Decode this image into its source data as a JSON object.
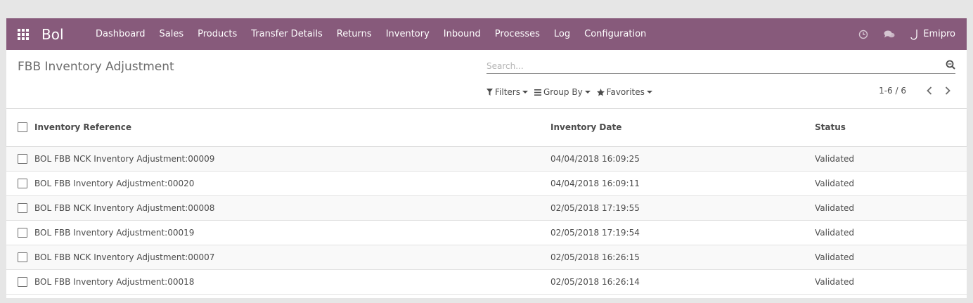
{
  "navbar": {
    "app_name": "Bol",
    "menu": [
      "Dashboard",
      "Sales",
      "Products",
      "Transfer Details",
      "Returns",
      "Inventory",
      "Inbound",
      "Processes",
      "Log",
      "Configuration"
    ],
    "user": "Emipro",
    "icons": [
      "apps-grid-icon",
      "clock-icon",
      "chat-icon",
      "user-logo-icon"
    ]
  },
  "control_panel": {
    "title": "FBB Inventory Adjustment",
    "search_placeholder": "Search...",
    "filters_label": "Filters",
    "group_by_label": "Group By",
    "favorites_label": "Favorites",
    "pager": "1-6 / 6"
  },
  "table": {
    "columns": [
      "Inventory Reference",
      "Inventory Date",
      "Status"
    ],
    "rows": [
      {
        "ref": "BOL FBB NCK Inventory Adjustment:00009",
        "date": "04/04/2018 16:09:25",
        "status": "Validated"
      },
      {
        "ref": "BOL FBB Inventory Adjustment:00020",
        "date": "04/04/2018 16:09:11",
        "status": "Validated"
      },
      {
        "ref": "BOL FBB NCK Inventory Adjustment:00008",
        "date": "02/05/2018 17:19:55",
        "status": "Validated"
      },
      {
        "ref": "BOL FBB Inventory Adjustment:00019",
        "date": "02/05/2018 17:19:54",
        "status": "Validated"
      },
      {
        "ref": "BOL FBB NCK Inventory Adjustment:00007",
        "date": "02/05/2018 16:26:15",
        "status": "Validated"
      },
      {
        "ref": "BOL FBB Inventory Adjustment:00018",
        "date": "02/05/2018 16:26:14",
        "status": "Validated"
      }
    ]
  },
  "colors": {
    "navbar_bg": "#875a7b",
    "page_bg": "#e6e6e6",
    "text": "#4c4c4c"
  }
}
